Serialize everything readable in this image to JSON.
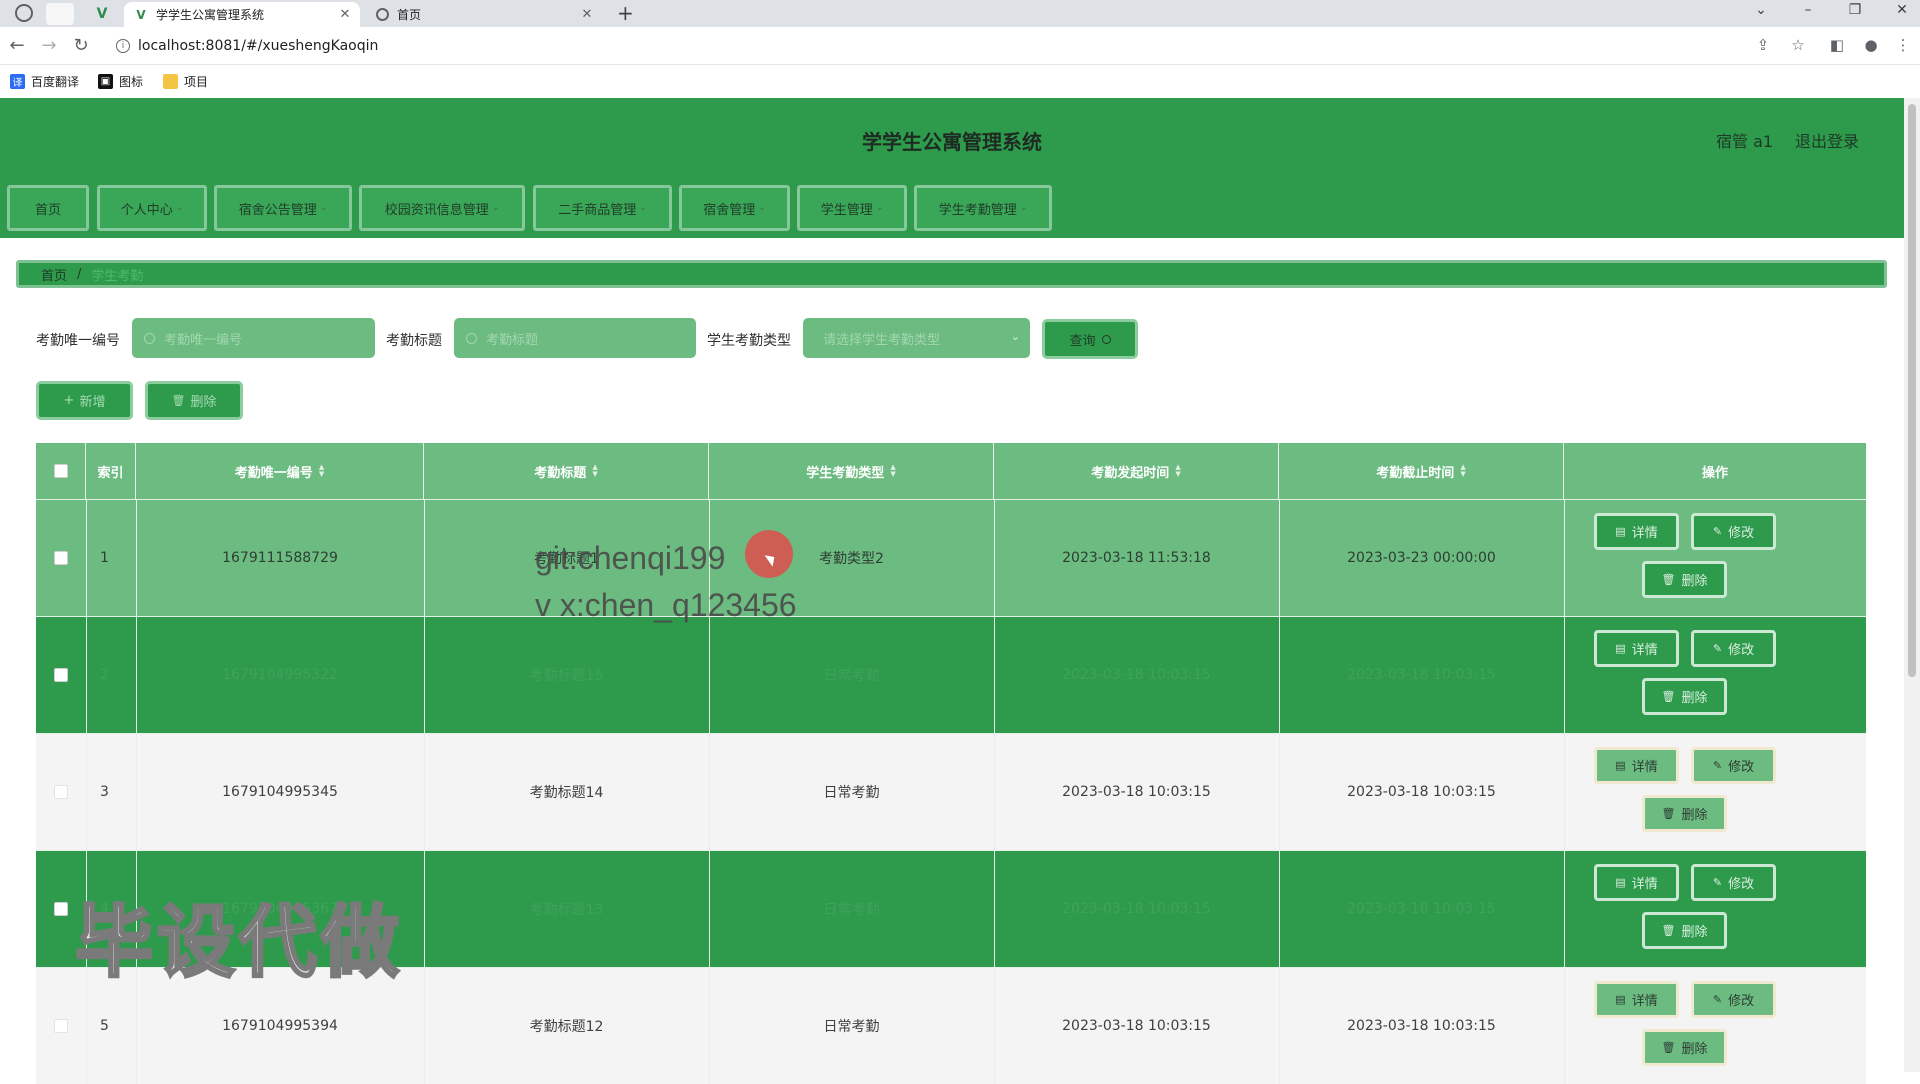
{
  "browser": {
    "tabs": [
      {
        "title": "学学生公寓管理系统",
        "active": true
      },
      {
        "title": "首页",
        "active": false
      }
    ],
    "url": "localhost:8081/#/xueshengKaoqin",
    "bookmarks": [
      "百度翻译",
      "图标",
      "项目"
    ]
  },
  "header": {
    "title": "学学生公寓管理系统",
    "user": "宿管 a1",
    "logout": "退出登录"
  },
  "menu": [
    {
      "label": "首页",
      "has_dropdown": false
    },
    {
      "label": "个人中心",
      "has_dropdown": true
    },
    {
      "label": "宿舍公告管理",
      "has_dropdown": true
    },
    {
      "label": "校园资讯信息管理",
      "has_dropdown": true
    },
    {
      "label": "二手商品管理",
      "has_dropdown": true
    },
    {
      "label": "宿舍管理",
      "has_dropdown": true
    },
    {
      "label": "学生管理",
      "has_dropdown": true
    },
    {
      "label": "学生考勤管理",
      "has_dropdown": true
    }
  ],
  "breadcrumb": {
    "home": "首页",
    "separator": "/",
    "current": "学生考勤"
  },
  "search": {
    "label1": "考勤唯一编号",
    "placeholder1": "考勤唯一编号",
    "label2": "考勤标题",
    "placeholder2": "考勤标题",
    "label3": "学生考勤类型",
    "select_placeholder": "请选择学生考勤类型",
    "query_button": "查询"
  },
  "actions": {
    "add": "新增",
    "delete": "删除"
  },
  "table": {
    "headers": [
      "索引",
      "考勤唯一编号",
      "考勤标题",
      "学生考勤类型",
      "考勤发起时间",
      "考勤截止时间",
      "操作"
    ],
    "rows": [
      {
        "index": "1",
        "id": "1679111588729",
        "title": "考勤标题1",
        "type": "考勤类型2",
        "start": "2023-03-18 11:53:18",
        "end": "2023-03-23 00:00:00",
        "style": "light"
      },
      {
        "index": "2",
        "id": "1679104995322",
        "title": "考勤标题15",
        "type": "日常考勤",
        "start": "2023-03-18 10:03:15",
        "end": "2023-03-18 10:03:15",
        "style": "green"
      },
      {
        "index": "3",
        "id": "1679104995345",
        "title": "考勤标题14",
        "type": "日常考勤",
        "start": "2023-03-18 10:03:15",
        "end": "2023-03-18 10:03:15",
        "style": "white"
      },
      {
        "index": "4",
        "id": "1679104995367",
        "title": "考勤标题13",
        "type": "日常考勤",
        "start": "2023-03-18 10:03:15",
        "end": "2023-03-18 10:03:15",
        "style": "green"
      },
      {
        "index": "5",
        "id": "1679104995394",
        "title": "考勤标题12",
        "type": "日常考勤",
        "start": "2023-03-18 10:03:15",
        "end": "2023-03-18 10:03:15",
        "style": "white"
      }
    ],
    "ops": {
      "detail": "详情",
      "edit": "修改",
      "delete": "删除"
    }
  },
  "overlay": {
    "line1": "git:chenqi199",
    "line2": "v x:chen_q123456",
    "watermark": "毕设代做"
  },
  "colors": {
    "primary": "#2e9a4c",
    "light": "#6cbb81",
    "border": "#8ccd9e"
  }
}
